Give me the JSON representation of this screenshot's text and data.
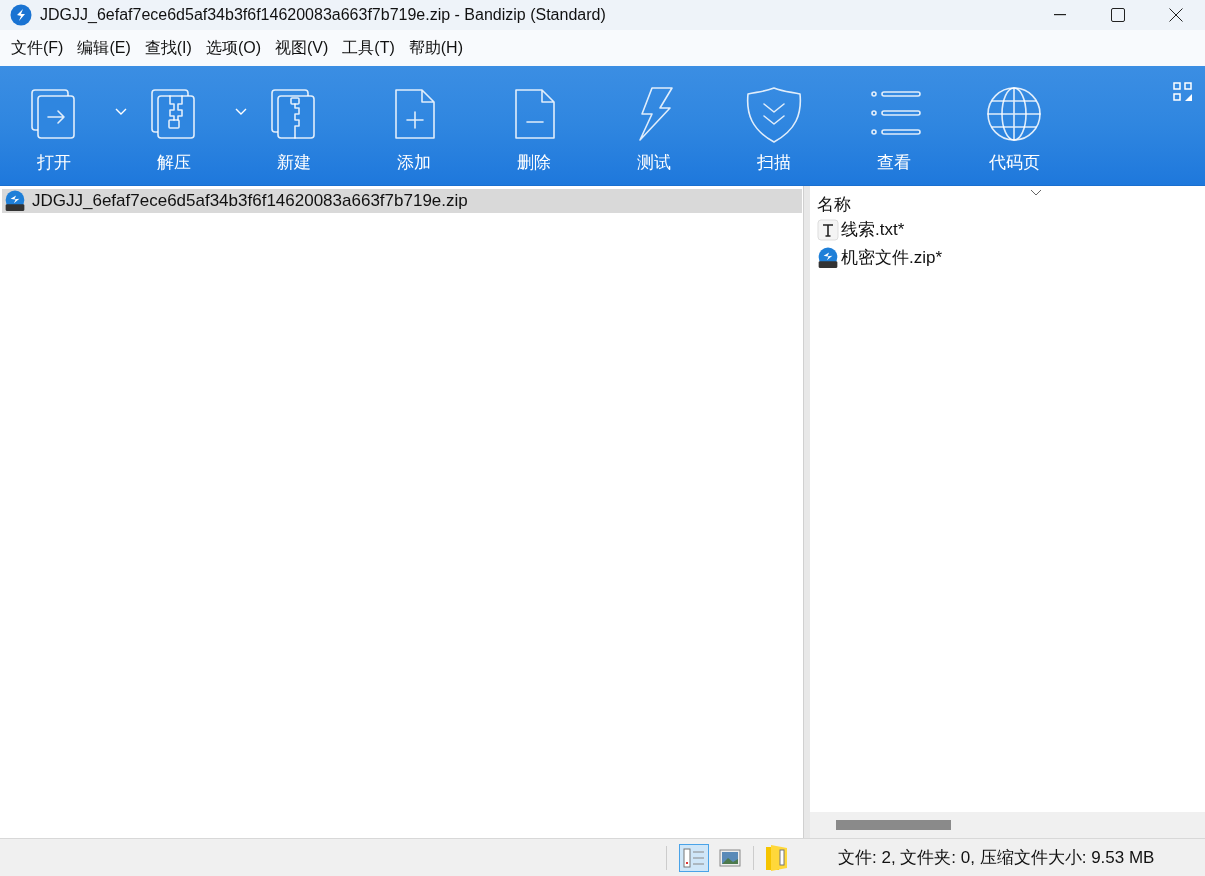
{
  "window": {
    "title": "JDGJJ_6efaf7ece6d5af34b3f6f14620083a663f7b719e.zip - Bandizip (Standard)"
  },
  "menu": [
    "文件(F)",
    "编辑(E)",
    "查找(I)",
    "选项(O)",
    "视图(V)",
    "工具(T)",
    "帮助(H)"
  ],
  "toolbar": [
    {
      "label": "打开",
      "has_menu": true
    },
    {
      "label": "解压",
      "has_menu": true
    },
    {
      "label": "新建",
      "has_menu": false
    },
    {
      "label": "添加",
      "has_menu": false
    },
    {
      "label": "删除",
      "has_menu": false
    },
    {
      "label": "测试",
      "has_menu": false
    },
    {
      "label": "扫描",
      "has_menu": false
    },
    {
      "label": "查看",
      "has_menu": false
    },
    {
      "label": "代码页",
      "has_menu": false
    }
  ],
  "tree": [
    {
      "label": "JDGJJ_6efaf7ece6d5af34b3f6f14620083a663f7b719e.zip",
      "selected": true
    }
  ],
  "file_list": {
    "columns": [
      "名称"
    ],
    "rows": [
      {
        "name": "线索.txt*",
        "kind": "text",
        "selected": false
      },
      {
        "name": "机密文件.zip*",
        "kind": "zip",
        "selected": false
      }
    ]
  },
  "status_bar": {
    "views": [
      {
        "kind": "list",
        "selected": true
      },
      {
        "kind": "thumbnail",
        "selected": false
      }
    ],
    "text": "文件: 2, 文件夹: 0, 压缩文件大小: 9.53 MB"
  }
}
